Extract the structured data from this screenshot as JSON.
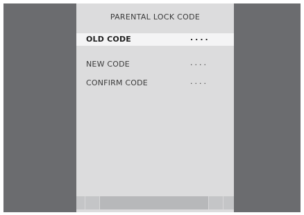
{
  "menu": {
    "title": "PARENTAL  LOCK  CODE",
    "items": [
      {
        "label": "OLD  CODE",
        "value": "....",
        "selected": true
      },
      {
        "label": "NEW  CODE",
        "value": "....",
        "selected": false
      },
      {
        "label": "CONFIRM  CODE",
        "value": "....",
        "selected": false
      }
    ]
  },
  "colors": {
    "frame": "#6b6c6f",
    "panel": "#dcdcdd",
    "highlight": "#f4f4f5",
    "text": "#3a3a3a"
  }
}
